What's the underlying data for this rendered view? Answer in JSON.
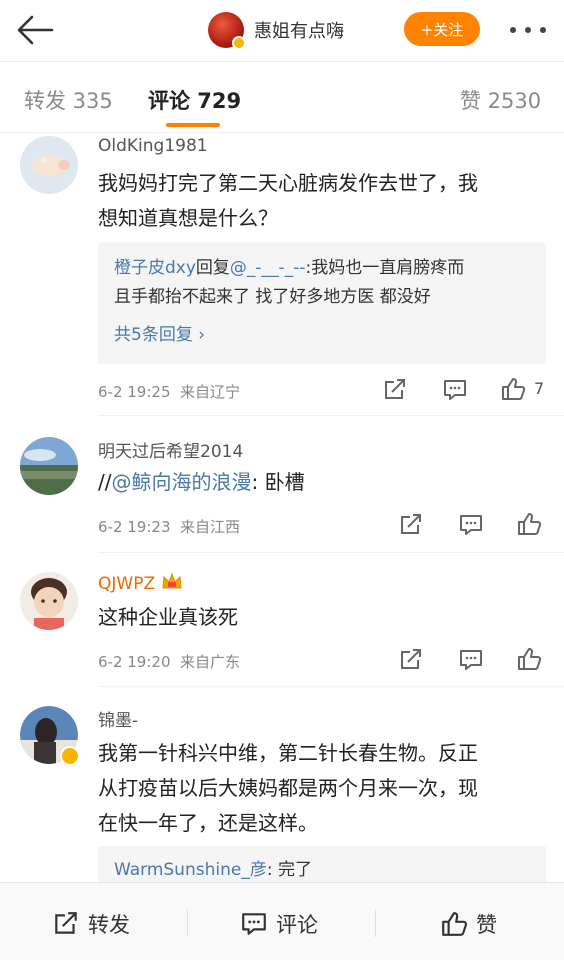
{
  "header": {
    "back_icon": "arrow-left-icon",
    "username": "惠姐有点嗨",
    "follow_label": "+关注",
    "more_icon": "more-dots-icon"
  },
  "tabs": [
    {
      "label": "转发 335"
    },
    {
      "label": "评论 729"
    },
    {
      "label": "赞 2530"
    }
  ],
  "comments": [
    {
      "name": "OldKing1981",
      "text_line1": "我妈妈打完了第二天心脏病发作去世了，我",
      "text_line2": "想知道真想是什么？",
      "reply": {
        "author": "橙子皮dxy",
        "verb": "回复",
        "target": "@_-__-_--",
        "text1": ":我妈也一直肩膀疼而",
        "text2": "且手都抬不起来了 找了好多地方医 都没好",
        "more": "共5条回复 ›"
      },
      "time": "6-2 19:25",
      "location": "来自辽宁",
      "likes": "7"
    },
    {
      "name": "明天过后希望2014",
      "prefix": "//",
      "mention": "@鲸向海的浪漫",
      "text": ": 卧槽",
      "time": "6-2 19:23",
      "location": "来自江西"
    },
    {
      "name": "QJWPZ",
      "text": "这种企业真该死",
      "time": "6-2 19:20",
      "location": "来自广东"
    },
    {
      "name": "锦墨-",
      "text_line1": "我第一针科兴中维，第二针长春生物。反正",
      "text_line2": "从打疫苗以后大姨妈都是两个月来一次，现",
      "text_line3": "在快一年了，还是这样。",
      "reply": {
        "author": "WarmSunshine_彦",
        "text": ": 完了"
      }
    }
  ],
  "bottom_bar": {
    "repost": "转发",
    "comment": "评论",
    "like": "赞"
  },
  "colors": {
    "accent": "#ff8200",
    "link": "#4a78ad"
  }
}
